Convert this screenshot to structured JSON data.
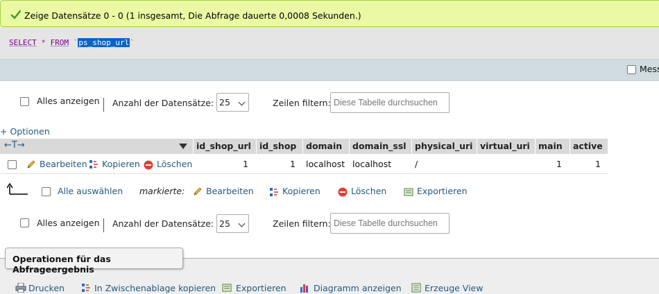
{
  "success": {
    "message": "Zeige Datensätze 0 - 0 (1 insgesamt, Die Abfrage dauerte 0,0008 Sekunden.)",
    "color": "#ebf8a4"
  },
  "sql": {
    "select": "SELECT",
    "star": "*",
    "from": "FROM",
    "tick_open": "`",
    "table": "ps_shop_url",
    "tick_close": "`"
  },
  "options_bar": {
    "label": "Mess"
  },
  "nav_top": {
    "show_all": "Alles anzeigen",
    "row_count_label": "Anzahl der Datensätze:",
    "row_count_value": "25",
    "filter_label": "Zeilen filtern:",
    "filter_placeholder": "Diese Tabelle durchsuchen"
  },
  "options_link": "+ Optionen",
  "table": {
    "arrows": "←T→",
    "columns": [
      "id_shop_url",
      "id_shop",
      "domain",
      "domain_ssl",
      "physical_uri",
      "virtual_uri",
      "main",
      "active"
    ],
    "rows": [
      {
        "edit": "Bearbeiten",
        "copy": "Kopieren",
        "delete": "Löschen",
        "cells": [
          "1",
          "1",
          "localhost",
          "localhost",
          "/",
          "",
          "1",
          "1"
        ]
      }
    ]
  },
  "bulk": {
    "select_all": "Alle auswählen",
    "marked": "markierte:",
    "edit": "Bearbeiten",
    "copy": "Kopieren",
    "delete": "Löschen",
    "export": "Exportieren"
  },
  "nav_bottom": {
    "show_all": "Alles anzeigen",
    "row_count_label": "Anzahl der Datensätze:",
    "row_count_value": "25",
    "filter_label": "Zeilen filtern:",
    "filter_placeholder": "Diese Tabelle durchsuchen"
  },
  "operations": {
    "legend": "Operationen für das Abfrageergebnis",
    "print": "Drucken",
    "clipboard": "In Zwischenablage kopieren",
    "export": "Exportieren",
    "chart": "Diagramm anzeigen",
    "view": "Erzeuge View"
  }
}
